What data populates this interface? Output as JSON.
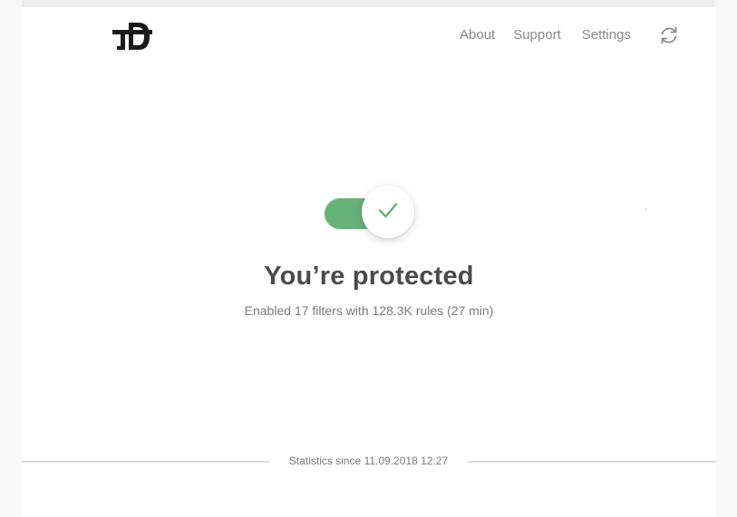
{
  "header": {
    "logo_icon": "adguard-td-logo-icon",
    "nav": {
      "about": "About",
      "support": "Support",
      "settings": "Settings"
    },
    "refresh_icon": "refresh-icon"
  },
  "protection": {
    "enabled": true,
    "toggle_icon": "checkmark-icon",
    "title": "You’re protected",
    "subtitle": "Enabled 17 filters with 128.3K rules (27 min)"
  },
  "footer": {
    "stats_label": "Statistics since 11.09.2018 12:27"
  },
  "colors": {
    "accent_green": "#67b279",
    "text_dark": "#4b4b4b",
    "text_muted": "#8a8a8a"
  }
}
